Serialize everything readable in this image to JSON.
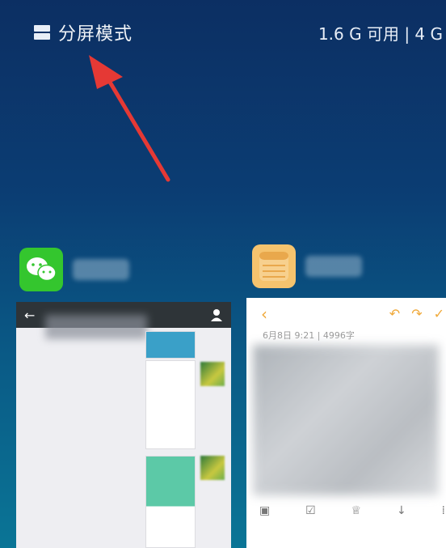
{
  "status": {
    "split_label": "分屏模式",
    "memory_label": "1.6 G 可用 | 4 G"
  },
  "apps": {
    "wechat": {
      "icon": "wechat-icon"
    },
    "notes": {
      "icon": "notes-icon",
      "date_line": "6月8日  9:21  |  4996字"
    }
  },
  "colors": {
    "arrow": "#e53935",
    "wechat_green": "#34c62e",
    "notes_yellow": "#f5c36e",
    "notes_accent": "#f0a93a"
  }
}
